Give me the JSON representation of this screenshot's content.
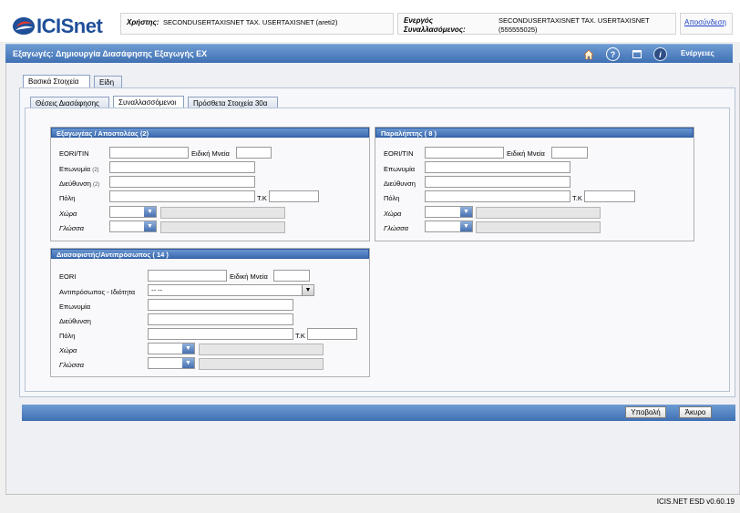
{
  "app": {
    "name": "ICISnet"
  },
  "header": {
    "user_label": "Χρήστης:",
    "user_value": "SECONDUSERTAXISNET TAX. USERTAXISNET (areti2)",
    "operator_label_1": "Ενεργός",
    "operator_label_2": "Συναλλασόμενος:",
    "operator_value_1": "SECONDUSERTAXISNET TAX. USERTAXISNET",
    "operator_value_2": "(555555025)",
    "logout": "Αποσύνδεση"
  },
  "titlebar": {
    "title": "Εξαγωγές: Δημιουργία Διασάφησης Εξαγωγής EX",
    "icons": [
      "home-icon",
      "help-icon",
      "window-icon",
      "info-icon"
    ],
    "actions": "Ενέργειες"
  },
  "tabs_main": [
    "Βασικά Στοιχεία",
    "Είδη"
  ],
  "tabs_sub": [
    "Θέσεις Διασάφησης",
    "Συναλλασσόμενοι",
    "Πρόσθετα Στοιχεία 30α"
  ],
  "exporter": {
    "title": "Εξαγωγέας / Αποστολέας (2)",
    "eori": "EORI/TIN",
    "special": "Ειδική Μνεία",
    "name": "Επωνυμία",
    "name_suffix": "(2)",
    "address": "Διεύθυνση",
    "address_suffix": "(2)",
    "city": "Πόλη",
    "postal": "Τ.Κ",
    "country": "Χώρα",
    "language": "Γλώσσα"
  },
  "consignee": {
    "title": "Παραλήπτης ( 8 )",
    "eori": "EORI/TIN",
    "special": "Ειδική Μνεία",
    "name": "Επωνυμία",
    "address": "Διεύθυνση",
    "city": "Πόλη",
    "postal": "Τ.Κ",
    "country": "Χώρα",
    "language": "Γλώσσα"
  },
  "declarant": {
    "title": "Διασαφιστής/Αντιπρόσωπος ( 14 )",
    "eori": "EORI",
    "special": "Ειδική Μνεία",
    "representative": "Αντιπρόσωπος - Ιδιότητα",
    "representative_value": "-- --",
    "name": "Επωνυμία",
    "address": "Διεύθυνση",
    "city": "Πόλη",
    "postal": "Τ.Κ",
    "country": "Χώρα",
    "language": "Γλώσσα"
  },
  "footer": {
    "submit": "Υποβολή",
    "cancel": "Άκυρο"
  },
  "status": {
    "version": "ICIS.NET ESD v0.60.19"
  }
}
